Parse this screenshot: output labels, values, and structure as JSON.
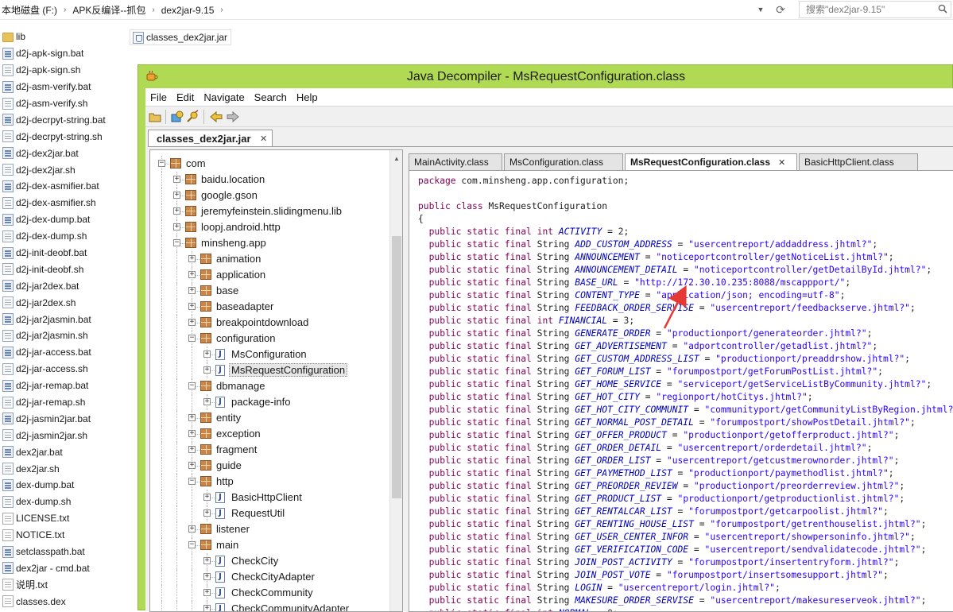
{
  "explorer": {
    "breadcrumbs": [
      "本地磁盘 (F:)",
      "APK反编译--抓包",
      "dex2jar-9.15"
    ],
    "search_placeholder": "搜索\"dex2jar-9.15\"",
    "files": [
      {
        "name": "lib",
        "icon": "folder-icon"
      },
      {
        "name": "d2j-apk-sign.bat",
        "icon": "bat-file-icon"
      },
      {
        "name": "d2j-apk-sign.sh",
        "icon": "sh-file-icon"
      },
      {
        "name": "d2j-asm-verify.bat",
        "icon": "bat-file-icon"
      },
      {
        "name": "d2j-asm-verify.sh",
        "icon": "sh-file-icon"
      },
      {
        "name": "d2j-decrpyt-string.bat",
        "icon": "bat-file-icon"
      },
      {
        "name": "d2j-decrpyt-string.sh",
        "icon": "sh-file-icon"
      },
      {
        "name": "d2j-dex2jar.bat",
        "icon": "bat-file-icon"
      },
      {
        "name": "d2j-dex2jar.sh",
        "icon": "sh-file-icon"
      },
      {
        "name": "d2j-dex-asmifier.bat",
        "icon": "bat-file-icon"
      },
      {
        "name": "d2j-dex-asmifier.sh",
        "icon": "sh-file-icon"
      },
      {
        "name": "d2j-dex-dump.bat",
        "icon": "bat-file-icon"
      },
      {
        "name": "d2j-dex-dump.sh",
        "icon": "sh-file-icon"
      },
      {
        "name": "d2j-init-deobf.bat",
        "icon": "bat-file-icon"
      },
      {
        "name": "d2j-init-deobf.sh",
        "icon": "sh-file-icon"
      },
      {
        "name": "d2j-jar2dex.bat",
        "icon": "bat-file-icon"
      },
      {
        "name": "d2j-jar2dex.sh",
        "icon": "sh-file-icon"
      },
      {
        "name": "d2j-jar2jasmin.bat",
        "icon": "bat-file-icon"
      },
      {
        "name": "d2j-jar2jasmin.sh",
        "icon": "sh-file-icon"
      },
      {
        "name": "d2j-jar-access.bat",
        "icon": "bat-file-icon"
      },
      {
        "name": "d2j-jar-access.sh",
        "icon": "sh-file-icon"
      },
      {
        "name": "d2j-jar-remap.bat",
        "icon": "bat-file-icon"
      },
      {
        "name": "d2j-jar-remap.sh",
        "icon": "sh-file-icon"
      },
      {
        "name": "d2j-jasmin2jar.bat",
        "icon": "bat-file-icon"
      },
      {
        "name": "d2j-jasmin2jar.sh",
        "icon": "sh-file-icon"
      },
      {
        "name": "dex2jar.bat",
        "icon": "bat-file-icon"
      },
      {
        "name": "dex2jar.sh",
        "icon": "sh-file-icon"
      },
      {
        "name": "dex-dump.bat",
        "icon": "bat-file-icon"
      },
      {
        "name": "dex-dump.sh",
        "icon": "sh-file-icon"
      },
      {
        "name": "LICENSE.txt",
        "icon": "txt-file-icon"
      },
      {
        "name": "NOTICE.txt",
        "icon": "txt-file-icon"
      },
      {
        "name": "setclasspath.bat",
        "icon": "bat-file-icon"
      },
      {
        "name": "dex2jar - cmd.bat",
        "icon": "bat-file-icon"
      },
      {
        "name": "说明.txt",
        "icon": "txt-file-icon"
      },
      {
        "name": "classes.dex",
        "icon": "txt-file-icon"
      }
    ],
    "jar_file": "classes_dex2jar.jar"
  },
  "jd": {
    "title": "Java Decompiler - MsRequestConfiguration.class",
    "menu": [
      "File",
      "Edit",
      "Navigate",
      "Search",
      "Help"
    ],
    "open_file_tab": "classes_dex2jar.jar",
    "tree": [
      {
        "label": "com",
        "kind": "package",
        "depth": 0,
        "expanded": true
      },
      {
        "label": "baidu.location",
        "kind": "package",
        "depth": 1,
        "expanded": false
      },
      {
        "label": "google.gson",
        "kind": "package",
        "depth": 1,
        "expanded": false
      },
      {
        "label": "jeremyfeinstein.slidingmenu.lib",
        "kind": "package",
        "depth": 1,
        "expanded": false
      },
      {
        "label": "loopj.android.http",
        "kind": "package",
        "depth": 1,
        "expanded": false
      },
      {
        "label": "minsheng.app",
        "kind": "package",
        "depth": 1,
        "expanded": true
      },
      {
        "label": "animation",
        "kind": "package",
        "depth": 2,
        "expanded": false
      },
      {
        "label": "application",
        "kind": "package",
        "depth": 2,
        "expanded": false
      },
      {
        "label": "base",
        "kind": "package",
        "depth": 2,
        "expanded": false
      },
      {
        "label": "baseadapter",
        "kind": "package",
        "depth": 2,
        "expanded": false
      },
      {
        "label": "breakpointdownload",
        "kind": "package",
        "depth": 2,
        "expanded": false
      },
      {
        "label": "configuration",
        "kind": "package",
        "depth": 2,
        "expanded": true
      },
      {
        "label": "MsConfiguration",
        "kind": "class",
        "depth": 3,
        "expanded": false
      },
      {
        "label": "MsRequestConfiguration",
        "kind": "class",
        "depth": 3,
        "expanded": false,
        "selected": true
      },
      {
        "label": "dbmanage",
        "kind": "package",
        "depth": 2,
        "expanded": true
      },
      {
        "label": "package-info",
        "kind": "class",
        "depth": 3,
        "expanded": false
      },
      {
        "label": "entity",
        "kind": "package",
        "depth": 2,
        "expanded": false
      },
      {
        "label": "exception",
        "kind": "package",
        "depth": 2,
        "expanded": false
      },
      {
        "label": "fragment",
        "kind": "package",
        "depth": 2,
        "expanded": false
      },
      {
        "label": "guide",
        "kind": "package",
        "depth": 2,
        "expanded": false
      },
      {
        "label": "http",
        "kind": "package",
        "depth": 2,
        "expanded": true
      },
      {
        "label": "BasicHttpClient",
        "kind": "class",
        "depth": 3,
        "expanded": false
      },
      {
        "label": "RequestUtil",
        "kind": "class",
        "depth": 3,
        "expanded": false
      },
      {
        "label": "listener",
        "kind": "package",
        "depth": 2,
        "expanded": false
      },
      {
        "label": "main",
        "kind": "package",
        "depth": 2,
        "expanded": true
      },
      {
        "label": "CheckCity",
        "kind": "class",
        "depth": 3,
        "expanded": false
      },
      {
        "label": "CheckCityAdapter",
        "kind": "class",
        "depth": 3,
        "expanded": false
      },
      {
        "label": "CheckCommunity",
        "kind": "class",
        "depth": 3,
        "expanded": false
      },
      {
        "label": "CheckCommunityAdapter",
        "kind": "class",
        "depth": 3,
        "expanded": false
      }
    ],
    "class_tabs": [
      {
        "label": "MainActivity.class",
        "active": false
      },
      {
        "label": "MsConfiguration.class",
        "active": false
      },
      {
        "label": "MsRequestConfiguration.class",
        "active": true
      },
      {
        "label": "BasicHttpClient.class",
        "active": false
      }
    ],
    "code": {
      "package_line": "com.minsheng.app.configuration;",
      "class_name": "MsRequestConfiguration",
      "fields": [
        {
          "type": "int",
          "name": "ACTIVITY",
          "value": "2",
          "is_string": false
        },
        {
          "type": "String",
          "name": "ADD_CUSTOM_ADDRESS",
          "value": "\"usercentreport/addaddress.jhtml?\"",
          "is_string": true
        },
        {
          "type": "String",
          "name": "ANNOUNCEMENT",
          "value": "\"noticeportcontroller/getNoticeList.jhtml?\"",
          "is_string": true
        },
        {
          "type": "String",
          "name": "ANNOUNCEMENT_DETAIL",
          "value": "\"noticeportcontroller/getDetailById.jhtml?\"",
          "is_string": true
        },
        {
          "type": "String",
          "name": "BASE_URL",
          "value": "\"http://172.30.10.235:8088/mscappport/\"",
          "is_string": true
        },
        {
          "type": "String",
          "name": "CONTENT_TYPE",
          "value": "\"application/json; encoding=utf-8\"",
          "is_string": true
        },
        {
          "type": "String",
          "name": "FEEDBACK_ORDER_SERVISE",
          "value": "\"usercentreport/feedbackserve.jhtml?\"",
          "is_string": true
        },
        {
          "type": "int",
          "name": "FINANCIAL",
          "value": "3",
          "is_string": false
        },
        {
          "type": "String",
          "name": "GENERATE_ORDER",
          "value": "\"productionport/generateorder.jhtml?\"",
          "is_string": true
        },
        {
          "type": "String",
          "name": "GET_ADVERTISEMENT",
          "value": "\"adportcontroller/getadlist.jhtml?\"",
          "is_string": true
        },
        {
          "type": "String",
          "name": "GET_CUSTOM_ADDRESS_LIST",
          "value": "\"productionport/preaddrshow.jhtml?\"",
          "is_string": true
        },
        {
          "type": "String",
          "name": "GET_FORUM_LIST",
          "value": "\"forumpostport/getForumPostList.jhtml?\"",
          "is_string": true
        },
        {
          "type": "String",
          "name": "GET_HOME_SERVICE",
          "value": "\"serviceport/getServiceListByCommunity.jhtml?\"",
          "is_string": true
        },
        {
          "type": "String",
          "name": "GET_HOT_CITY",
          "value": "\"regionport/hotCitys.jhtml?\"",
          "is_string": true
        },
        {
          "type": "String",
          "name": "GET_HOT_CITY_COMMUNIT",
          "value": "\"communityport/getCommunityListByRegion.jhtml?\"",
          "is_string": true
        },
        {
          "type": "String",
          "name": "GET_NORMAL_POST_DETAIL",
          "value": "\"forumpostport/showPostDetail.jhtml?\"",
          "is_string": true
        },
        {
          "type": "String",
          "name": "GET_OFFER_PRODUCT",
          "value": "\"productionport/getofferproduct.jhtml?\"",
          "is_string": true
        },
        {
          "type": "String",
          "name": "GET_ORDER_DETAIL",
          "value": "\"usercentreport/orderdetail.jhtml?\"",
          "is_string": true
        },
        {
          "type": "String",
          "name": "GET_ORDER_LIST",
          "value": "\"usercentreport/getcustmerownorder.jhtml?\"",
          "is_string": true
        },
        {
          "type": "String",
          "name": "GET_PAYMETHOD_LIST",
          "value": "\"productionport/paymethodlist.jhtml?\"",
          "is_string": true
        },
        {
          "type": "String",
          "name": "GET_PREORDER_REVIEW",
          "value": "\"productionport/preorderreview.jhtml?\"",
          "is_string": true
        },
        {
          "type": "String",
          "name": "GET_PRODUCT_LIST",
          "value": "\"productionport/getproductionlist.jhtml?\"",
          "is_string": true
        },
        {
          "type": "String",
          "name": "GET_RENTALCAR_LIST",
          "value": "\"forumpostport/getcarpoolist.jhtml?\"",
          "is_string": true
        },
        {
          "type": "String",
          "name": "GET_RENTING_HOUSE_LIST",
          "value": "\"forumpostport/getrenthouselist.jhtml?\"",
          "is_string": true
        },
        {
          "type": "String",
          "name": "GET_USER_CENTER_INFOR",
          "value": "\"usercentreport/showpersoninfo.jhtml?\"",
          "is_string": true
        },
        {
          "type": "String",
          "name": "GET_VERIFICATION_CODE",
          "value": "\"usercentreport/sendvalidatecode.jhtml?\"",
          "is_string": true
        },
        {
          "type": "String",
          "name": "JOIN_POST_ACTIVITY",
          "value": "\"forumpostport/insertentryform.jhtml?\"",
          "is_string": true
        },
        {
          "type": "String",
          "name": "JOIN_POST_VOTE",
          "value": "\"forumpostport/insertsomesupport.jhtml?\"",
          "is_string": true
        },
        {
          "type": "String",
          "name": "LOGIN",
          "value": "\"usercentreport/login.jhtml?\"",
          "is_string": true
        },
        {
          "type": "String",
          "name": "MAKESURE_ORDER_SERVISE",
          "value": "\"usercentreport/makesureserveok.jhtml?\"",
          "is_string": true
        },
        {
          "type": "int",
          "name": "NORMAL",
          "value": "0",
          "is_string": false
        }
      ]
    }
  },
  "colors": {
    "window_frame": "#b0da54",
    "keyword": "#7f0055",
    "field": "#0000c0",
    "string": "#2a00ff",
    "annotation_arrow": "#e53935"
  }
}
